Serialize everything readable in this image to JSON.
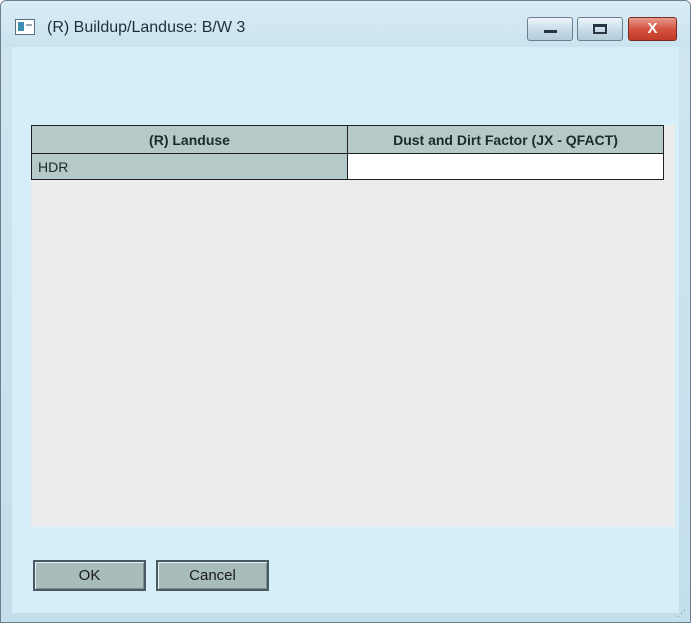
{
  "window": {
    "title": "(R) Buildup/Landuse: B/W 3",
    "controls": {
      "minimize_icon": "minimize-icon",
      "maximize_icon": "maximize-icon",
      "close_label": "X"
    }
  },
  "grid": {
    "columns": [
      "(R) Landuse",
      "Dust and Dirt Factor (JX - QFACT)"
    ],
    "rows": [
      {
        "landuse": "HDR",
        "factor": ""
      }
    ]
  },
  "buttons": {
    "ok_label": "OK",
    "cancel_label": "Cancel"
  },
  "colors": {
    "header_bg": "#b5c9c9",
    "window_bg": "#d5eef7",
    "close_button": "#d3533f"
  }
}
